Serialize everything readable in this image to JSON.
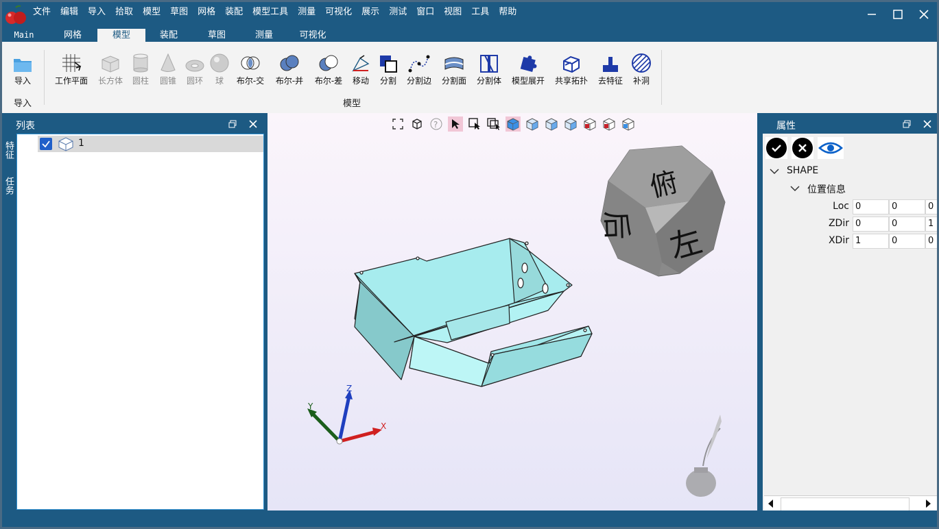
{
  "menu": [
    "文件",
    "编辑",
    "导入",
    "拾取",
    "模型",
    "草图",
    "网格",
    "装配",
    "模型工具",
    "测量",
    "可视化",
    "展示",
    "测试",
    "窗口",
    "视图",
    "工具",
    "帮助"
  ],
  "tabs": [
    "Main",
    "网格",
    "模型",
    "装配",
    "草图",
    "测量",
    "可视化"
  ],
  "active_tab": "模型",
  "ribbon": {
    "import_label": "导入",
    "import_group": "导入",
    "model_group": "模型",
    "buttons": [
      "工作平面",
      "长方体",
      "圆柱",
      "圆锥",
      "圆环",
      "球",
      "布尔-交",
      "布尔-并",
      "布尔-差",
      "移动",
      "分割",
      "分割边",
      "分割面",
      "分割体",
      "模型展开",
      "共享拓扑",
      "去特征",
      "补洞"
    ]
  },
  "list_panel": {
    "title": "列表",
    "side_tabs": [
      "特征",
      "任务"
    ],
    "items": [
      {
        "label": "1",
        "checked": true
      }
    ]
  },
  "viewport": {
    "cube_faces": {
      "top": "俯",
      "front": "左",
      "side": "后"
    },
    "axes": {
      "x": "X",
      "y": "Y",
      "z": "Z"
    }
  },
  "properties": {
    "title": "属性",
    "shape_label": "SHAPE",
    "group_label": "位置信息",
    "rows": [
      {
        "name": "Loc",
        "values": [
          "0",
          "0",
          "0"
        ]
      },
      {
        "name": "ZDir",
        "values": [
          "0",
          "0",
          "1"
        ]
      },
      {
        "name": "XDir",
        "values": [
          "1",
          "0",
          "0"
        ]
      }
    ]
  },
  "colors": {
    "accent": "#1d5a83",
    "model": "#9fe3e6",
    "selection": "#0b61c9"
  }
}
